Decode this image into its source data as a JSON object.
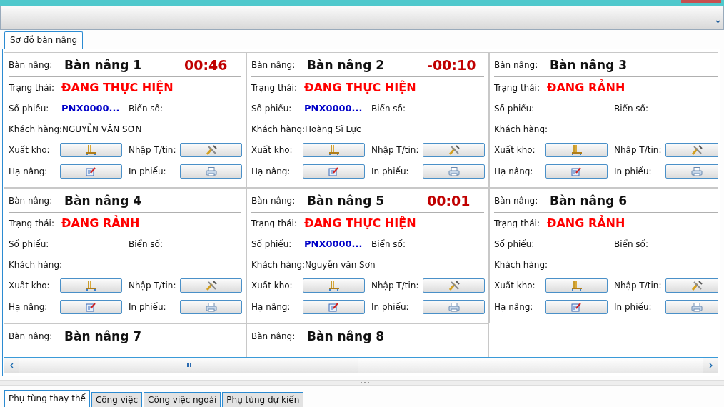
{
  "top_tabs": [
    {
      "label": "Sơ đồ bàn nâng",
      "selected": true
    }
  ],
  "lifts": [
    {
      "label": "Bàn nâng:",
      "name": "Bàn nâng 1",
      "timer": "00:46",
      "status_label": "Trạng thái:",
      "status": "ĐANG THỰC HIỆN",
      "ticket_label": "Số phiếu:",
      "ticket": "PNX0000...",
      "plate_label": "Biển số:",
      "customer_label": "Khách hàng:",
      "customer": "NGUYỄN VĂN SƠN",
      "actions": [
        "Xuất kho:",
        "Nhập T/tin:",
        "Hạ nâng:",
        "In phiếu:"
      ]
    },
    {
      "label": "Bàn nâng:",
      "name": "Bàn nâng 2",
      "timer": "-00:10",
      "status_label": "Trạng thái:",
      "status": "ĐANG THỰC HIỆN",
      "ticket_label": "Số phiếu:",
      "ticket": "PNX0000...",
      "plate_label": "Biển số:",
      "customer_label": "Khách hàng:",
      "customer": "Hoàng Sĩ Lực",
      "actions": [
        "Xuất kho:",
        "Nhập T/tin:",
        "Hạ nâng:",
        "In phiếu:"
      ]
    },
    {
      "label": "Bàn nâng:",
      "name": "Bàn nâng 3",
      "status_label": "Trạng thái:",
      "status": "ĐANG RẢNH",
      "ticket_label": "Số phiếu:",
      "plate_label": "Biển số:",
      "customer_label": "Khách hàng:",
      "actions": [
        "Xuất kho:",
        "Nhập T/tin:",
        "Hạ nâng:",
        "In phiếu:"
      ]
    },
    {
      "label": "Bàn nâng:",
      "name": "Bàn nâng 4",
      "status_label": "Trạng thái:",
      "status": "ĐANG RẢNH",
      "ticket_label": "Số phiếu:",
      "plate_label": "Biển số:",
      "customer_label": "Khách hàng:",
      "actions": [
        "Xuất kho:",
        "Nhập T/tin:",
        "Hạ nâng:",
        "In phiếu:"
      ]
    },
    {
      "label": "Bàn nâng:",
      "name": "Bàn nâng 5",
      "timer": "00:01",
      "status_label": "Trạng thái:",
      "status": "ĐANG THỰC HIỆN",
      "ticket_label": "Số phiếu:",
      "ticket": "PNX0000...",
      "plate_label": "Biển số:",
      "customer_label": "Khách hàng:",
      "customer": "Nguyễn văn Sơn",
      "actions": [
        "Xuất kho:",
        "Nhập T/tin:",
        "Hạ nâng:",
        "In phiếu:"
      ]
    },
    {
      "label": "Bàn nâng:",
      "name": "Bàn nâng 6",
      "status_label": "Trạng thái:",
      "status": "ĐANG RẢNH",
      "ticket_label": "Số phiếu:",
      "plate_label": "Biển số:",
      "customer_label": "Khách hàng:",
      "actions": [
        "Xuất kho:",
        "Nhập T/tin:",
        "Hạ nâng:",
        "In phiếu:"
      ]
    },
    {
      "label": "Bàn nâng:",
      "name": "Bàn nâng 7"
    },
    {
      "label": "Bàn nâng:",
      "name": "Bàn nâng 8"
    }
  ],
  "bottom_tabs": [
    {
      "label": "Phụ tùng thay thế",
      "selected": true
    },
    {
      "label": "Công việc",
      "selected": false
    },
    {
      "label": "Công việc ngoài",
      "selected": false
    },
    {
      "label": "Phụ tùng dự kiến",
      "selected": false
    }
  ]
}
